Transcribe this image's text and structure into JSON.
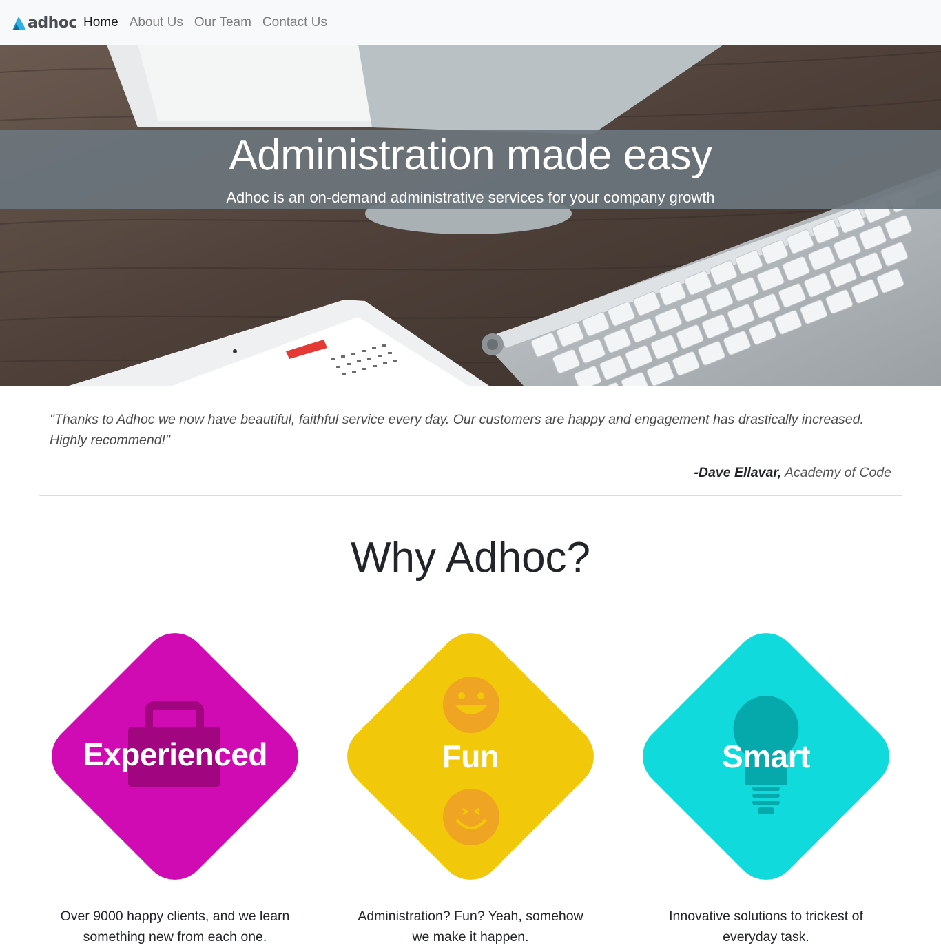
{
  "navbar": {
    "brand": "adhoc",
    "logo_icon": "triangle-logo-icon",
    "links": [
      {
        "label": "Home",
        "active": true
      },
      {
        "label": "About Us",
        "active": false
      },
      {
        "label": "Our Team",
        "active": false
      },
      {
        "label": "Contact Us",
        "active": false
      }
    ]
  },
  "hero": {
    "title": "Administration made easy",
    "subtitle": "Adhoc is an on-demand administrative services for your company growth",
    "background": "desk-with-keyboard-and-tablet-photo"
  },
  "testimonial": {
    "quote": "\"Thanks to Adhoc we now have beautiful, faithful service every day. Our customers are happy and engagement has drastically increased. Highly recommend!\"",
    "author": "-Dave Ellavar,",
    "organization": "Academy of Code"
  },
  "why": {
    "heading": "Why Adhoc?",
    "features": [
      {
        "title": "Experienced",
        "description": "Over 9000 happy clients, and we learn something new from each one.",
        "color": "#d10bb3",
        "icon": "briefcase-icon"
      },
      {
        "title": "Fun",
        "description": "Administration? Fun? Yeah, somehow we make it happen.",
        "color": "#f2c80a",
        "icon": "smiley-face-icon"
      },
      {
        "title": "Smart",
        "description": "Innovative solutions to trickest of everyday task.",
        "color": "#10dadb",
        "icon": "lightbulb-icon"
      }
    ]
  },
  "colors": {
    "navbar_bg": "#f8f9fa",
    "hero_band": "#6c757d",
    "text": "#212529"
  }
}
